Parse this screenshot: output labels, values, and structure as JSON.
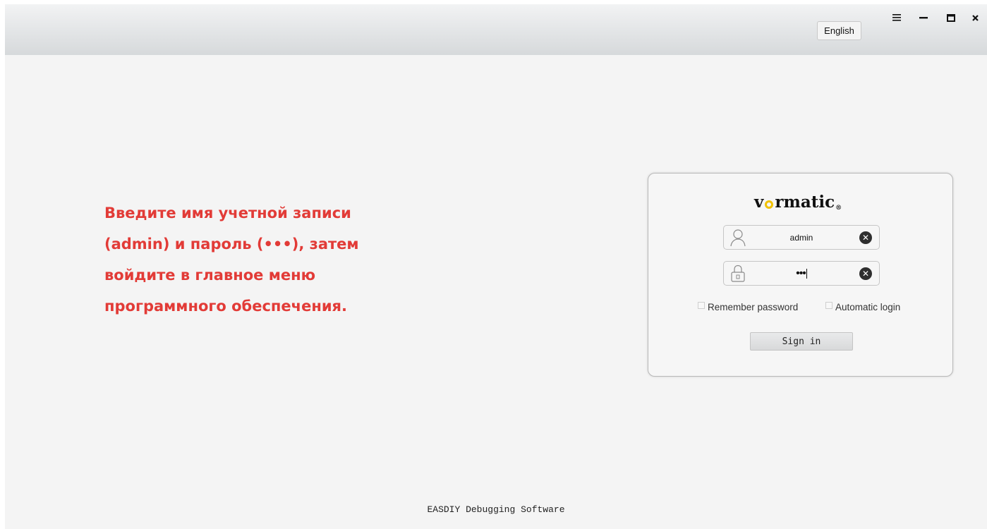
{
  "titlebar": {
    "language_button": "English",
    "controls": {
      "menu_icon": "hamburger-icon",
      "minimize_icon": "minimize-icon",
      "maximize_icon": "maximize-icon",
      "close_icon": "close-icon"
    }
  },
  "instruction": {
    "lines": [
      "Введите имя учетной записи",
      "(admin) и пароль (•••), затем",
      "войдите в главное меню",
      "программного обеспечения."
    ],
    "color": "#e23b37"
  },
  "login": {
    "logo_text": {
      "before": "v",
      "after": "rmatic",
      "mark": "®"
    },
    "logo_accent": "#f2c200",
    "username": {
      "value": "admin",
      "icon": "user-icon",
      "clear_icon": "clear-icon"
    },
    "password": {
      "value": "•••",
      "icon": "lock-icon",
      "clear_icon": "clear-icon"
    },
    "remember_password": {
      "label": "Remember password",
      "checked": false
    },
    "automatic_login": {
      "label": "Automatic login",
      "checked": false
    },
    "sign_in_label": "Sign in"
  },
  "footer": {
    "text": "EASDIY Debugging Software"
  }
}
